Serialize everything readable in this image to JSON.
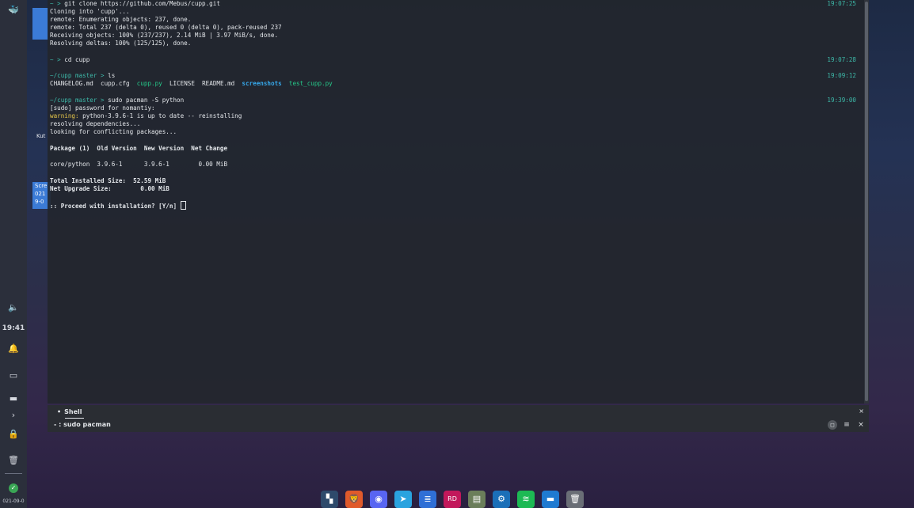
{
  "left_panel": {
    "clock": "19:41",
    "date": "021-09-0",
    "icons": [
      "app-launcher-icon",
      "volume-icon",
      "notification-bell-icon",
      "screen-icon",
      "monitor-icon",
      "chevron-right-icon",
      "lock-icon",
      "trash-icon",
      "status-check-icon"
    ]
  },
  "desktop": {
    "label_1": "Kut",
    "screenshot_label_1": "Scre",
    "screenshot_label_2": "021",
    "screenshot_label_3": "9-0"
  },
  "terminal": {
    "lines": [
      {
        "prompt": "~ > ",
        "cmd": "git clone https://github.com/Mebus/cupp.git",
        "time": "19:07:25"
      },
      {
        "text": "Cloning into 'cupp'..."
      },
      {
        "text": "remote: Enumerating objects: 237, done."
      },
      {
        "text": "remote: Total 237 (delta 0), reused 0 (delta 0), pack-reused 237"
      },
      {
        "text": "Receiving objects: 100% (237/237), 2.14 MiB | 3.97 MiB/s, done."
      },
      {
        "text": "Resolving deltas: 100% (125/125), done."
      },
      {
        "prompt": "~ > ",
        "cmd": "cd cupp",
        "time": "19:07:28"
      },
      {
        "prompt": "~/cupp master > ",
        "cmd": "ls",
        "time": "19:09:12"
      },
      {
        "ls": [
          "CHANGELOG.md",
          "cupp.cfg",
          "cupp.py",
          "LICENSE",
          "README.md",
          "screenshots",
          "test_cupp.py"
        ]
      },
      {
        "prompt": "~/cupp master > ",
        "cmd": "sudo pacman -S python",
        "time": "19:39:00"
      },
      {
        "text": "[sudo] password for nomantiy:"
      },
      {
        "warn_label": "warning:",
        "text": " python-3.9.6-1 is up to date -- reinstalling"
      },
      {
        "text": "resolving dependencies..."
      },
      {
        "text": "looking for conflicting packages..."
      },
      {
        "text": "Package (1)  Old Version  New Version  Net Change"
      },
      {
        "text": "core/python  3.9.6-1      3.9.6-1        0.00 MiB"
      },
      {
        "text": "Total Installed Size:  52.59 MiB"
      },
      {
        "text": "Net Upgrade Size:        0.00 MiB"
      },
      {
        "text": ":: Proceed with installation? [Y/n] "
      }
    ]
  },
  "shell_panel": {
    "tab_label": "Shell",
    "tab_marker": "•",
    "task_label": "- : sudo pacman",
    "close_top": "×",
    "btn_menu": "≡",
    "btn_close": "×",
    "btn_float": "◻"
  },
  "dock": {
    "apps": [
      {
        "name": "tiling-manager-icon",
        "color": "#2e4a6b",
        "glyph": "▚"
      },
      {
        "name": "brave-browser-icon",
        "color": "#e05a2b",
        "glyph": "🦁"
      },
      {
        "name": "discord-icon",
        "color": "#5865f2",
        "glyph": "◉"
      },
      {
        "name": "telegram-icon",
        "color": "#2aa3df",
        "glyph": "➤"
      },
      {
        "name": "notes-icon",
        "color": "#2f6fd6",
        "glyph": "≣"
      },
      {
        "name": "rider-ide-icon",
        "color": "#c2185b",
        "glyph": "RD"
      },
      {
        "name": "file-manager-icon",
        "color": "#6b7e5a",
        "glyph": "▤"
      },
      {
        "name": "steam-icon",
        "color": "#1b6fb8",
        "glyph": "⚙"
      },
      {
        "name": "spotify-icon",
        "color": "#1db954",
        "glyph": "≋"
      },
      {
        "name": "folder-icon",
        "color": "#1f7ad1",
        "glyph": "▬"
      },
      {
        "name": "trash-icon",
        "color": "#6a6e76",
        "glyph": "🗑"
      }
    ]
  }
}
